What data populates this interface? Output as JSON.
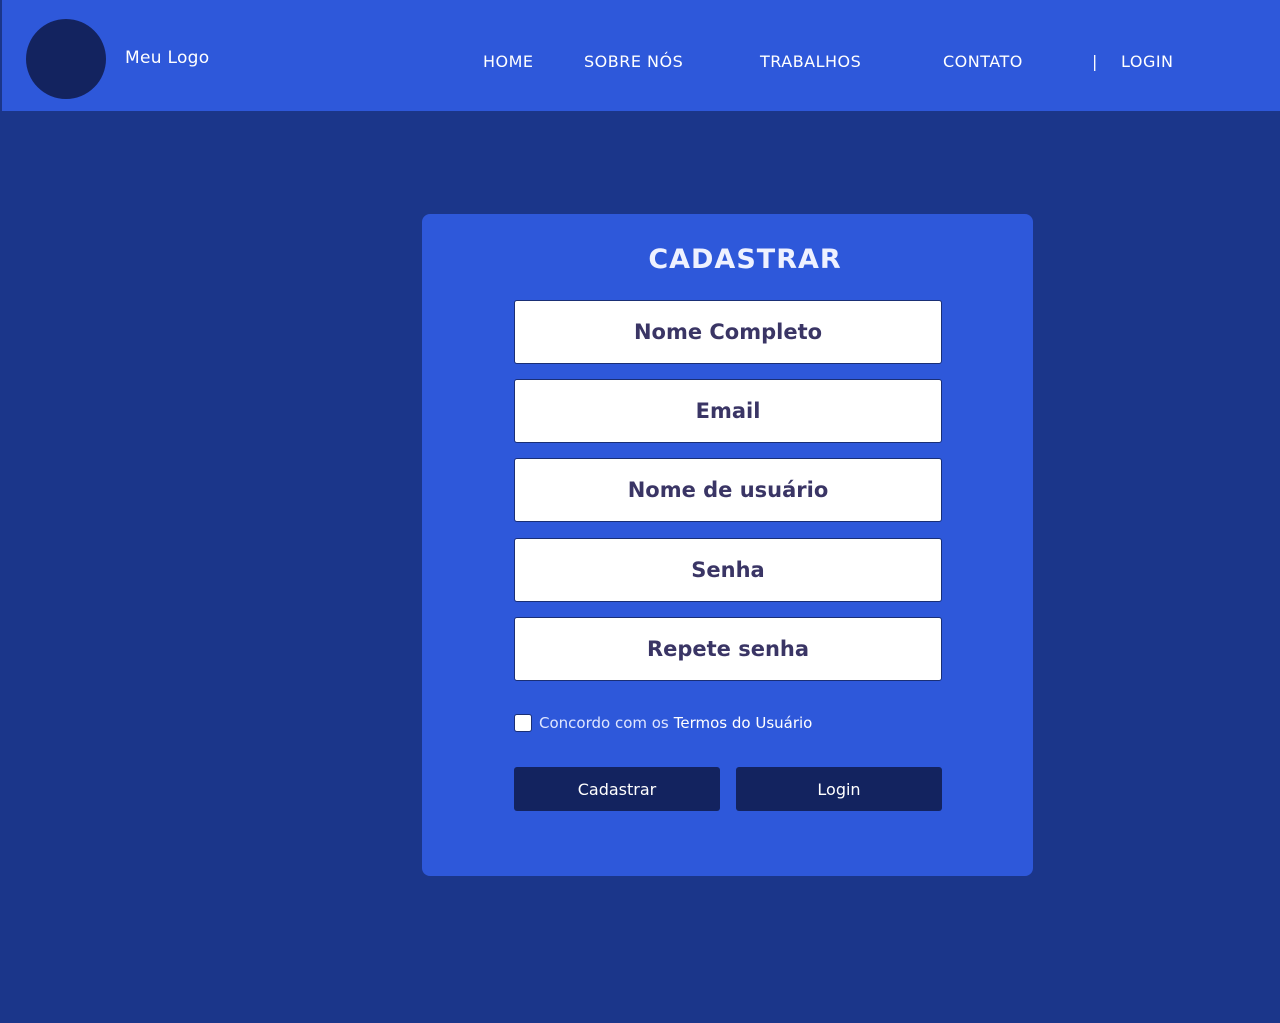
{
  "header": {
    "logo_text": "Meu Logo",
    "nav": [
      {
        "label": "HOME"
      },
      {
        "label": "SOBRE NÓS"
      },
      {
        "label": "TRABALHOS"
      },
      {
        "label": "CONTATO"
      }
    ],
    "separator": "|",
    "login_label": "LOGIN"
  },
  "form": {
    "title": "CADASTRAR",
    "fields": [
      {
        "placeholder": "Nome Completo"
      },
      {
        "placeholder": "Email"
      },
      {
        "placeholder": "Nome de usuário"
      },
      {
        "placeholder": "Senha"
      },
      {
        "placeholder": "Repete senha"
      }
    ],
    "terms_text": "Concordo com os",
    "terms_link": "Termos do Usuário",
    "submit_label": "Cadastrar",
    "login_label": "Login"
  },
  "colors": {
    "background": "#1b368a",
    "header": "#2e58da",
    "card": "#2e58da",
    "button": "#13235f",
    "field_text": "#3a3565"
  }
}
